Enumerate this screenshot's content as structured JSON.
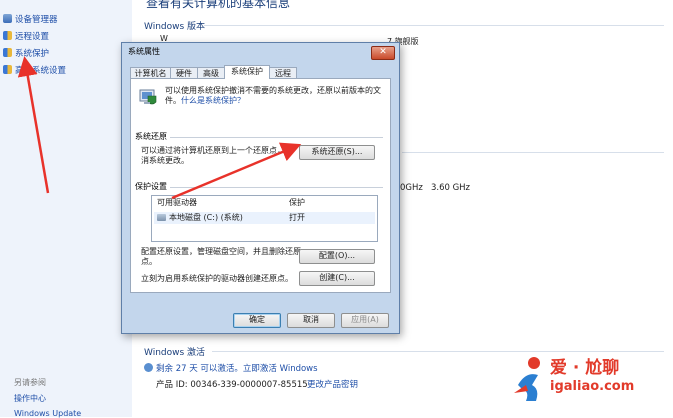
{
  "left_pane": {
    "items": [
      {
        "label": "设备管理器",
        "icon": "device-manager-icon"
      },
      {
        "label": "远程设置",
        "icon": "shield-icon"
      },
      {
        "label": "系统保护",
        "icon": "shield-icon"
      },
      {
        "label": "高级系统设置",
        "icon": "shield-icon"
      }
    ],
    "footer_heading": "另请参阅",
    "footer_links": [
      "操作中心",
      "Windows Update"
    ]
  },
  "main": {
    "page_title": "查看有关计算机的基本信息",
    "edition_heading": "Windows 版本",
    "edition_partial": "W",
    "edition_value": "7 旗舰版",
    "processor_partial": "0GHz   3.60 GHz",
    "activation_heading": "Windows 激活",
    "activation_status": "剩余 27 天 可以激活。立即激活 Windows",
    "product_id": "产品 ID: 00346-339-0000007-85515",
    "change_key_link": "更改产品密钥"
  },
  "dialog": {
    "title": "系统属性",
    "close_glyph": "✕",
    "tabs": [
      "计算机名",
      "硬件",
      "高级",
      "系统保护",
      "远程"
    ],
    "active_tab": "系统保护",
    "intro_text": "可以使用系统保护撤消不需要的系统更改，还原以前版本的文件。什么是系统保护？",
    "intro_main": "可以使用系统保护撤消不需要的系统更改，还原以前版本的文件。",
    "intro_link": "什么是系统保护？",
    "restore_group": "系统还原",
    "restore_text": "可以通过将计算机还原到上一个还原点，撤消系统更改。",
    "restore_button": "系统还原(S)...",
    "protection_group": "保护设置",
    "col_drive": "可用驱动器",
    "col_protection": "保护",
    "drives": [
      {
        "name": "本地磁盘 (C:) (系统)",
        "protection": "打开"
      }
    ],
    "configure_text": "配置还原设置，管理磁盘空间，并且删除还原点。",
    "configure_button": "配置(O)...",
    "create_text": "立刻为启用系统保护的驱动器创建还原点。",
    "create_button": "创建(C)...",
    "ok_button": "确定",
    "cancel_button": "取消",
    "apply_button": "应用(A)"
  },
  "watermark": {
    "brand": "爱 · 尬聊",
    "url": "igaliao.com"
  },
  "colors": {
    "arrow": "#e8322a",
    "link": "#1f4fa8",
    "dialog_frame": "#c3d6ec",
    "watermark": "#e23a2a"
  }
}
